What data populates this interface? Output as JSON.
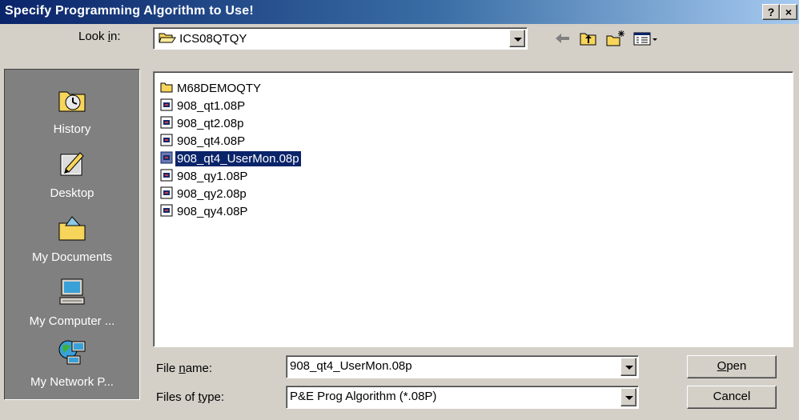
{
  "window": {
    "title": "Specify Programming Algorithm to Use!",
    "help_label": "?",
    "close_label": "×"
  },
  "lookin": {
    "label_pre": "Look ",
    "label_key": "i",
    "label_post": "n:",
    "value": "ICS08QTQY"
  },
  "toolbar": {
    "back_icon": "back-arrow-icon",
    "up_icon": "up-folder-icon",
    "new_folder_icon": "new-folder-icon",
    "views_icon": "views-menu-icon"
  },
  "places": [
    {
      "label": "History",
      "icon": "history-icon"
    },
    {
      "label": "Desktop",
      "icon": "desktop-icon"
    },
    {
      "label": "My Documents",
      "icon": "my-documents-icon"
    },
    {
      "label": "My Computer ...",
      "icon": "my-computer-icon"
    },
    {
      "label": "My Network P...",
      "icon": "my-network-places-icon"
    }
  ],
  "files": [
    {
      "name": "M68DEMOQTY",
      "type": "folder"
    },
    {
      "name": "908_qt1.08P",
      "type": "file"
    },
    {
      "name": "908_qt2.08p",
      "type": "file"
    },
    {
      "name": "908_qt4.08P",
      "type": "file"
    },
    {
      "name": "908_qt4_UserMon.08p",
      "type": "file",
      "selected": true
    },
    {
      "name": "908_qy1.08P",
      "type": "file"
    },
    {
      "name": "908_qy2.08p",
      "type": "file"
    },
    {
      "name": "908_qy4.08P",
      "type": "file"
    }
  ],
  "filename": {
    "label_pre": "File ",
    "label_key": "n",
    "label_post": "ame:",
    "value": "908_qt4_UserMon.08p"
  },
  "filetype": {
    "label_pre": "Files of ",
    "label_key": "t",
    "label_post": "ype:",
    "value": "P&E Prog Algorithm (*.08P)"
  },
  "buttons": {
    "open_key": "O",
    "open_rest": "pen",
    "cancel": "Cancel"
  },
  "colors": {
    "titlebar_start": "#0a246a",
    "titlebar_end": "#a6caf0",
    "selection": "#0a246a",
    "face": "#d4d0c8",
    "places_bg": "#808080"
  }
}
